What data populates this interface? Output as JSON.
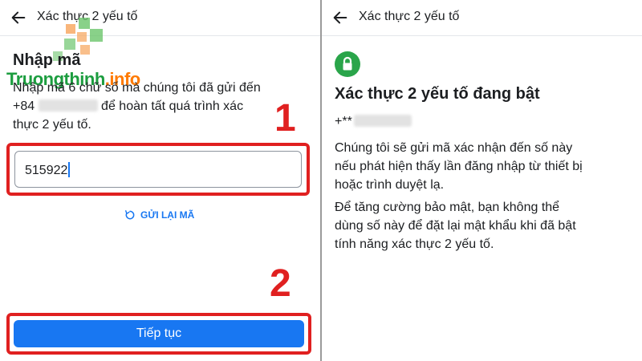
{
  "left_panel": {
    "header": {
      "title": "Xác thực 2 yếu tố",
      "back_icon": "arrow-left-icon"
    },
    "heading": "Nhập mã",
    "instructions": {
      "line1": "Nhập mã 6 chữ số mà chúng tôi đã gửi đến",
      "phone_prefix": "+84",
      "line2_rest": "để hoàn tất quá trình xác",
      "line3": "thực 2 yếu tố."
    },
    "code_input": {
      "value": "515922"
    },
    "resend_link": {
      "label": "GỬI LẠI MÃ",
      "icon": "refresh-icon"
    },
    "continue_button": {
      "label": "Tiếp tục"
    },
    "step_markers": {
      "first": "1",
      "second": "2"
    },
    "watermark": {
      "text_part1": "Truongthinh",
      "text_part2": ".info"
    }
  },
  "right_panel": {
    "header": {
      "title": "Xác thực 2 yếu tố",
      "back_icon": "arrow-left-icon"
    },
    "status_icon": "lock-icon",
    "heading": "Xác thực 2 yếu tố đang bật",
    "masked_phone_prefix": "+**",
    "paragraph1": {
      "line1": "Chúng tôi sẽ gửi mã xác nhận đến số này",
      "line2": "nếu phát hiện thấy lần đăng nhập từ thiết bị",
      "line3": "hoặc trình duyệt lạ."
    },
    "paragraph2": {
      "line1": "Để tăng cường bảo mật, bạn không thể",
      "line2": "dùng số này để đặt lại mật khẩu khi đã bật",
      "line3": "tính năng xác thực 2 yếu tố."
    }
  },
  "colors": {
    "accent": "#1877f2",
    "highlight": "#e02020",
    "lock": "#2aa54a"
  }
}
